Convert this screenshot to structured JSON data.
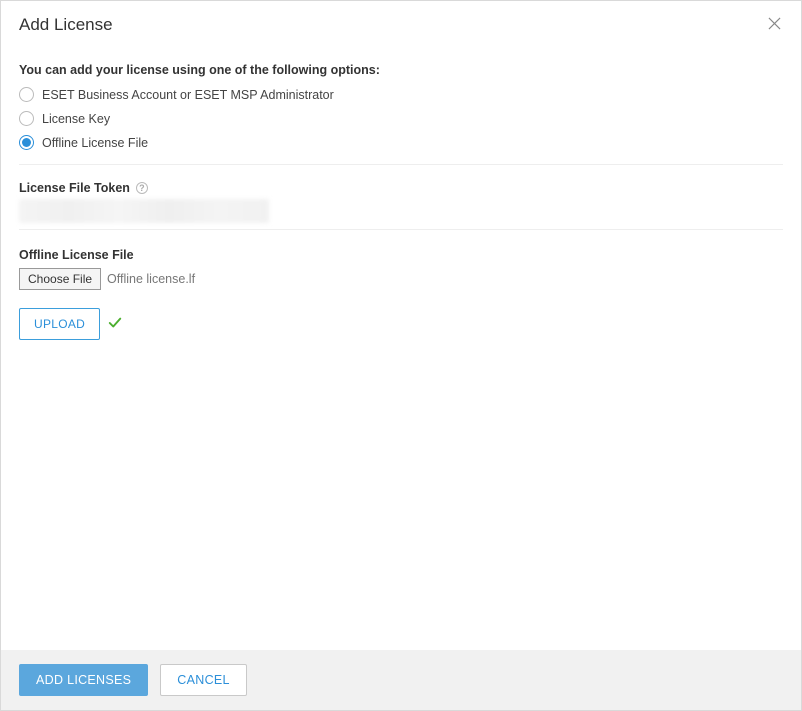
{
  "dialog": {
    "title": "Add License",
    "intro": "You can add your license using one of the following options:",
    "options": [
      {
        "label": "ESET Business Account or ESET MSP Administrator",
        "selected": false
      },
      {
        "label": "License Key",
        "selected": false
      },
      {
        "label": "Offline License File",
        "selected": true
      }
    ],
    "token_section": {
      "label": "License File Token"
    },
    "file_section": {
      "label": "Offline License File",
      "choose_btn": "Choose File",
      "file_name": "Offline license.lf",
      "upload_btn": "UPLOAD"
    },
    "footer": {
      "add_btn": "ADD LICENSES",
      "cancel_btn": "CANCEL"
    }
  }
}
